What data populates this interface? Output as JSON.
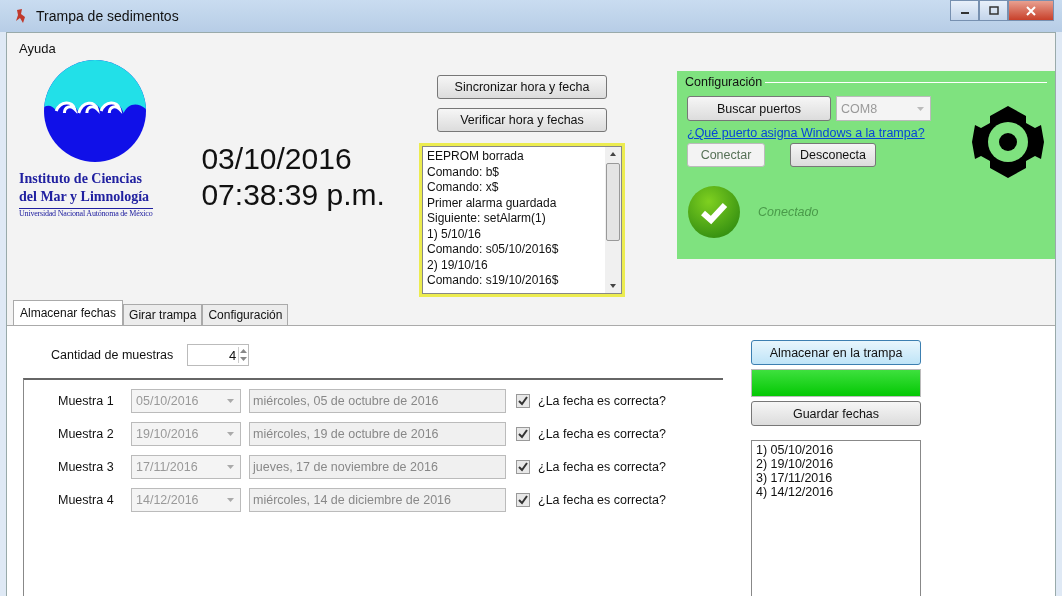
{
  "window": {
    "title": "Trampa de sedimentos"
  },
  "menu": [
    "Ayuda"
  ],
  "logo": {
    "line_1": "Instituto de Ciencias",
    "line_2": "del Mar y Limnología",
    "line_3": "Universidad Nacional Autónoma de México"
  },
  "clock": {
    "date": "03/10/2016",
    "time": "07:38:39 p.m."
  },
  "sync_buttons": [
    "Sincronizar hora y fecha",
    "Verificar hora y fechas"
  ],
  "log": [
    "EEPROM borrada",
    "Comando: b$",
    "Comando: x$",
    "Primer alarma guardada",
    "Siguiente: setAlarm(1)",
    "1) 5/10/16",
    "Comando: s05/10/2016$",
    "2) 19/10/16",
    "Comando: s19/10/2016$"
  ],
  "config": {
    "title": "Configuración",
    "search_button": "Buscar puertos",
    "port": "COM8",
    "help_link": "¿Qué puerto asigna Windows a la trampa?",
    "connect_button": {
      "label": "Conectar",
      "disabled": true
    },
    "disconnect_button": {
      "label": "Desconecta",
      "disabled": false
    },
    "status": "Conectado"
  },
  "tabs": [
    {
      "label": "Almacenar fechas",
      "selected": true
    },
    {
      "label": "Girar trampa",
      "selected": false
    },
    {
      "label": "Configuración",
      "selected": false
    }
  ],
  "sample_count": {
    "label": "Cantidad de muestras",
    "value": "4"
  },
  "samples": [
    {
      "label": "Muestra 1",
      "date": "05/10/2016",
      "long_date": "miércoles, 05 de octubre de 2016",
      "checked": true,
      "check_label": "¿La fecha es correcta?"
    },
    {
      "label": "Muestra 2",
      "date": "19/10/2016",
      "long_date": "miércoles, 19 de octubre de 2016",
      "checked": true,
      "check_label": "¿La fecha es correcta?"
    },
    {
      "label": "Muestra 3",
      "date": "17/11/2016",
      "long_date": "jueves, 17 de noviembre de 2016",
      "checked": true,
      "check_label": "¿La fecha es correcta?"
    },
    {
      "label": "Muestra 4",
      "date": "14/12/2016",
      "long_date": "miércoles, 14 de diciembre de 2016",
      "checked": true,
      "check_label": "¿La fecha es correcta?"
    }
  ],
  "store_button": "Almacenar en la trampa",
  "progress": {
    "level": 1
  },
  "save_button": "Guardar fechas",
  "saved_dates": [
    "1) 05/10/2016",
    "2) 19/10/2016",
    "3) 17/11/2016",
    "4) 14/12/2016"
  ]
}
